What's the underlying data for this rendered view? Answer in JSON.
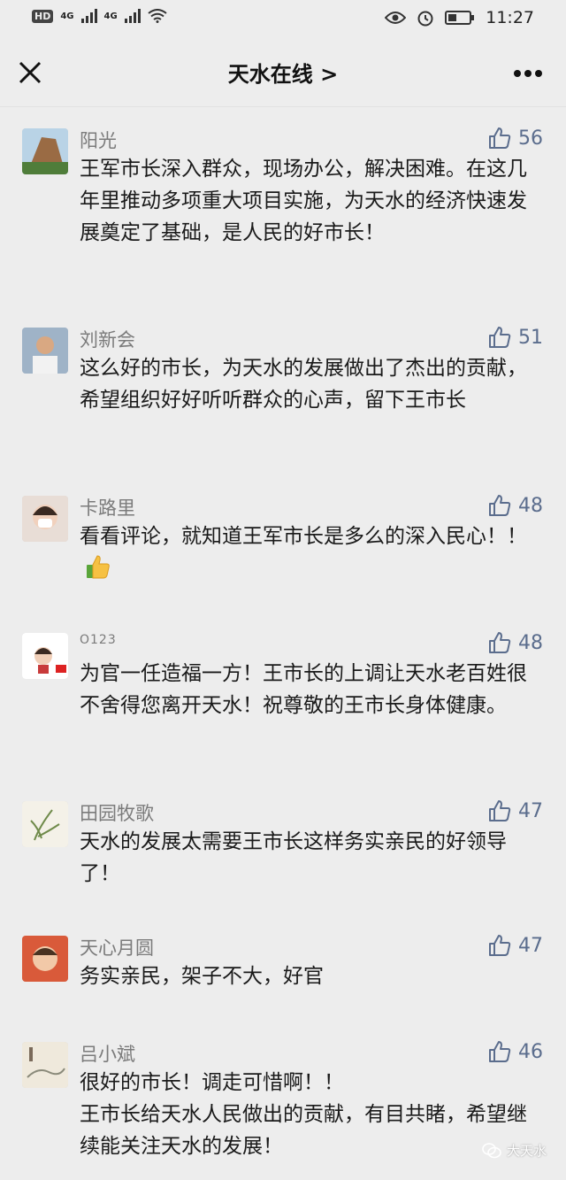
{
  "status": {
    "network1": "4G",
    "network2": "4G",
    "time": "11:27",
    "hd": "HD"
  },
  "nav": {
    "title": "天水在线 >"
  },
  "comments": [
    {
      "name": "阳光",
      "likes": "56",
      "text": "王军市长深入群众，现场办公，解决困难。在这几年里推动多项重大项目实施，为天水的经济快速发展奠定了基础，是人民的好市长！"
    },
    {
      "name": "刘新会",
      "likes": "51",
      "text": "这么好的市长，为天水的发展做出了杰出的贡献，希望组织好好听听群众的心声，留下王市长"
    },
    {
      "name": "卡路里",
      "likes": "48",
      "text": "看看评论，就知道王军市长是多么的深入民心！！"
    },
    {
      "name": "O123",
      "likes": "48",
      "text": "为官一任造福一方！王市长的上调让天水老百姓很不舍得您离开天水！祝尊敬的王市长身体健康。"
    },
    {
      "name": "田园牧歌",
      "likes": "47",
      "text": "天水的发展太需要王市长这样务实亲民的好领导了！"
    },
    {
      "name": "天心月圆",
      "likes": "47",
      "text": "务实亲民，架子不大，好官"
    },
    {
      "name": "吕小斌",
      "likes": "46",
      "text": "很好的市长！调走可惜啊！！\n王市长给天水人民做出的贡献，有目共睹，希望继续能关注天水的发展！"
    }
  ],
  "watermark": "大天水",
  "icons": {
    "like": "thumbs-up-icon",
    "close": "close-icon",
    "more": "more-icon"
  }
}
